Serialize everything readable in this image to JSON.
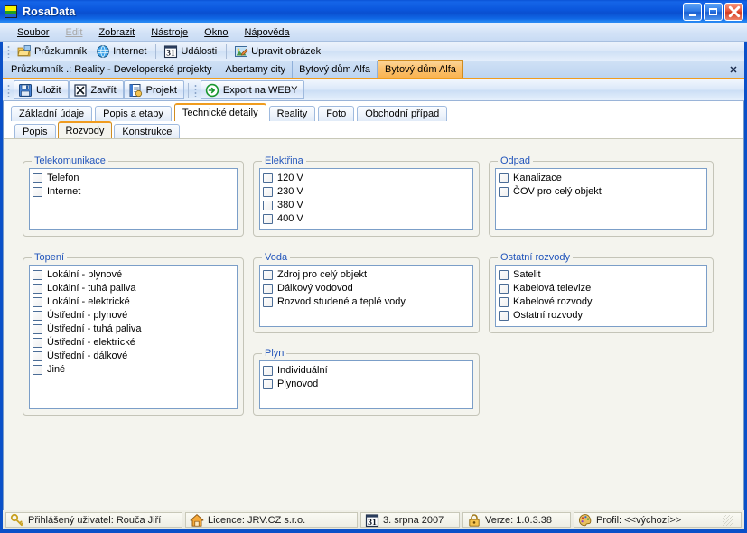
{
  "window": {
    "title": "RosaData",
    "icon": "rosadata-logo-icon",
    "minimize_label": "Minimalizovat",
    "maximize_label": "Maximalizovat",
    "close_label": "Zavřít"
  },
  "menubar": {
    "items": [
      {
        "label": "Soubor",
        "disabled": false
      },
      {
        "label": "Edit",
        "disabled": true
      },
      {
        "label": "Zobrazit",
        "disabled": false
      },
      {
        "label": "Nástroje",
        "disabled": false
      },
      {
        "label": "Okno",
        "disabled": false
      },
      {
        "label": "Nápověda",
        "disabled": false
      }
    ]
  },
  "main_toolbar": {
    "buttons": [
      {
        "label": "Průzkumník",
        "icon": "folder-explorer-icon"
      },
      {
        "label": "Internet",
        "icon": "globe-icon"
      },
      {
        "label": "Události",
        "icon": "calendar-31-icon"
      },
      {
        "label": "Upravit obrázek",
        "icon": "picture-edit-icon"
      }
    ]
  },
  "document_tabs": {
    "items": [
      {
        "label": "Průzkumník .: Reality - Developerské projekty",
        "active": false
      },
      {
        "label": "Abertamy city",
        "active": false
      },
      {
        "label": "Bytový dům Alfa",
        "active": false
      },
      {
        "label": "Bytový dům Alfa",
        "active": true
      }
    ],
    "close_label": "✕"
  },
  "sub_toolbar": {
    "buttons": [
      {
        "label": "Uložit",
        "icon": "save-disk-icon"
      },
      {
        "label": "Zavřít",
        "icon": "close-x-icon"
      },
      {
        "label": "Projekt",
        "icon": "project-icon"
      },
      {
        "label": "Export na WEBY",
        "icon": "export-arrow-icon"
      }
    ]
  },
  "tabs_level1": [
    {
      "label": "Základní údaje",
      "active": false
    },
    {
      "label": "Popis a etapy",
      "active": false
    },
    {
      "label": "Technické detaily",
      "active": true
    },
    {
      "label": "Reality",
      "active": false
    },
    {
      "label": "Foto",
      "active": false
    },
    {
      "label": "Obchodní případ",
      "active": false
    }
  ],
  "tabs_level2": [
    {
      "label": "Popis",
      "active": false
    },
    {
      "label": "Rozvody",
      "active": true
    },
    {
      "label": "Konstrukce",
      "active": false
    }
  ],
  "groups": [
    {
      "id": "telekomunikace",
      "title": "Telekomunikace",
      "items": [
        {
          "label": "Telefon",
          "checked": false
        },
        {
          "label": "Internet",
          "checked": false
        }
      ]
    },
    {
      "id": "elektrina",
      "title": "Elektřina",
      "items": [
        {
          "label": "120 V",
          "checked": false
        },
        {
          "label": "230 V",
          "checked": false
        },
        {
          "label": "380 V",
          "checked": false
        },
        {
          "label": "400 V",
          "checked": false
        }
      ]
    },
    {
      "id": "odpad",
      "title": "Odpad",
      "items": [
        {
          "label": "Kanalizace",
          "checked": false
        },
        {
          "label": "ČOV pro celý objekt",
          "checked": false
        }
      ]
    },
    {
      "id": "topeni",
      "title": "Topení",
      "items": [
        {
          "label": "Lokální - plynové",
          "checked": false
        },
        {
          "label": "Lokální - tuhá paliva",
          "checked": false
        },
        {
          "label": "Lokální - elektrické",
          "checked": false
        },
        {
          "label": "Ústřední - plynové",
          "checked": false
        },
        {
          "label": "Ústřední - tuhá paliva",
          "checked": false
        },
        {
          "label": "Ústřední - elektrické",
          "checked": false
        },
        {
          "label": "Ústřední - dálkové",
          "checked": false
        },
        {
          "label": "Jiné",
          "checked": false
        }
      ]
    },
    {
      "id": "voda",
      "title": "Voda",
      "items": [
        {
          "label": "Zdroj pro celý objekt",
          "checked": false
        },
        {
          "label": "Dálkový vodovod",
          "checked": false
        },
        {
          "label": "Rozvod studené a teplé vody",
          "checked": false
        }
      ]
    },
    {
      "id": "ostatni-rozvody",
      "title": "Ostatní rozvody",
      "items": [
        {
          "label": "Satelit",
          "checked": false
        },
        {
          "label": "Kabelová televize",
          "checked": false
        },
        {
          "label": "Kabelové rozvody",
          "checked": false
        },
        {
          "label": "Ostatní rozvody",
          "checked": false
        }
      ]
    },
    {
      "id": "plyn",
      "title": "Plyn",
      "items": [
        {
          "label": "Individuální",
          "checked": false
        },
        {
          "label": "Plynovod",
          "checked": false
        }
      ]
    }
  ],
  "statusbar": {
    "cells": [
      {
        "text": "Přihlášený uživatel: Rouča Jiří",
        "icon": "key-icon"
      },
      {
        "text": "Licence: JRV.CZ s.r.o.",
        "icon": "house-icon"
      },
      {
        "text": "3. srpna 2007",
        "icon": "calendar-31-icon"
      },
      {
        "text": "Verze: 1.0.3.38",
        "icon": "lock-icon"
      },
      {
        "text": "Profil: <<výchozí>>",
        "icon": "palette-icon"
      }
    ]
  },
  "colors": {
    "titlebar_blue": "#0a52d6",
    "frame_blue": "#0a50c8",
    "active_tab_orange": "#f9b451",
    "tab_underline_orange": "#f09c1e",
    "group_title_blue": "#2255bb",
    "form_background": "#f4f4ee",
    "list_background": "#ffffff"
  }
}
